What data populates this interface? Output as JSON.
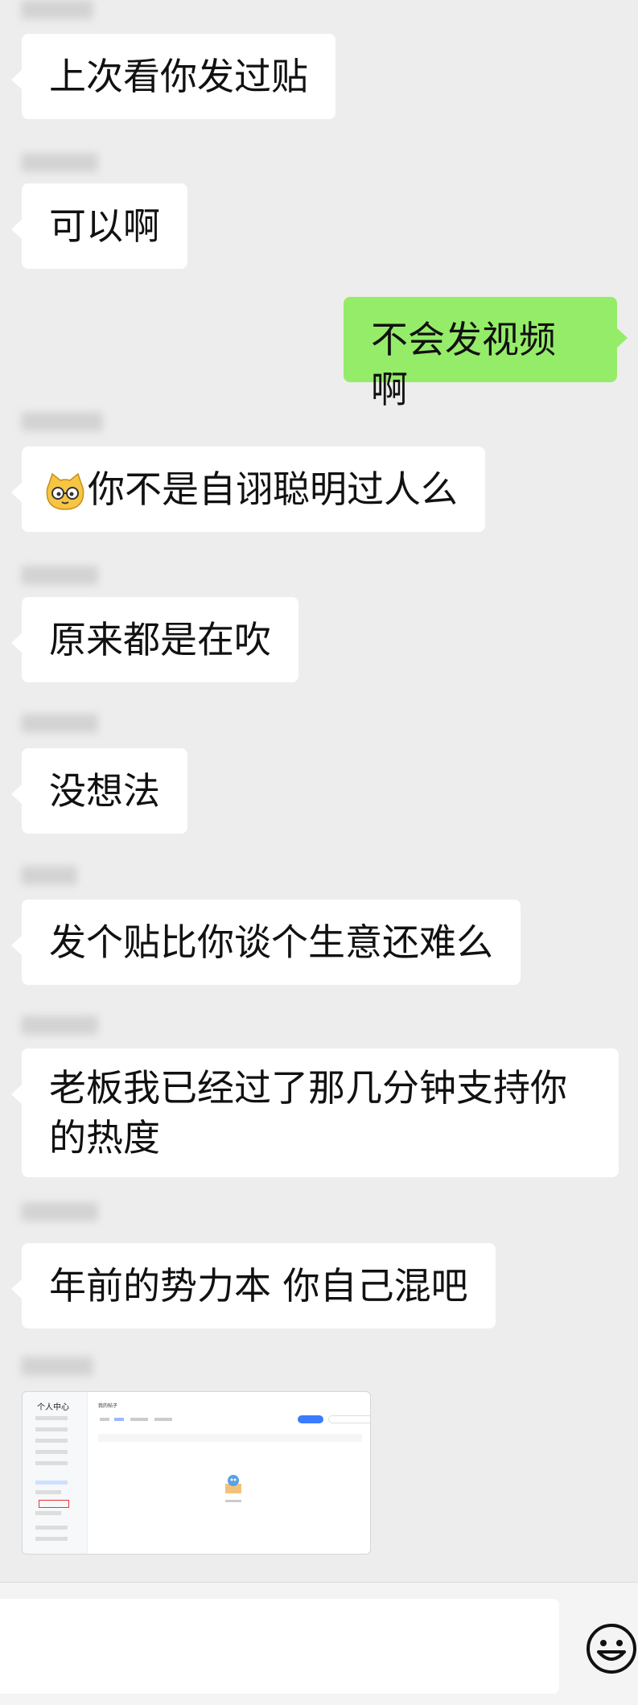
{
  "messages": [
    {
      "side": "left",
      "text": "上次看你发过贴"
    },
    {
      "side": "left",
      "text": "可以啊"
    },
    {
      "side": "right",
      "text": "不会发视频啊"
    },
    {
      "side": "left",
      "text": "你不是自诩聪明过人么",
      "emoji": "cat-glasses-emoji"
    },
    {
      "side": "left",
      "text": "原来都是在吹"
    },
    {
      "side": "left",
      "text": "没想法"
    },
    {
      "side": "left",
      "text": "发个贴比你谈个生意还难么"
    },
    {
      "side": "left",
      "text": "老板我已经过了那几分钟支持你的热度"
    },
    {
      "side": "left",
      "text": "年前的势力本 你自己混吧"
    }
  ],
  "screenshot_thumbnail": {
    "title": "个人中心",
    "heading": "我的帖子"
  },
  "input_bar": {
    "emoji_icon": "smiley-face-icon"
  },
  "colors": {
    "background": "#ededed",
    "left_bubble": "#ffffff",
    "right_bubble": "#95ec69"
  }
}
